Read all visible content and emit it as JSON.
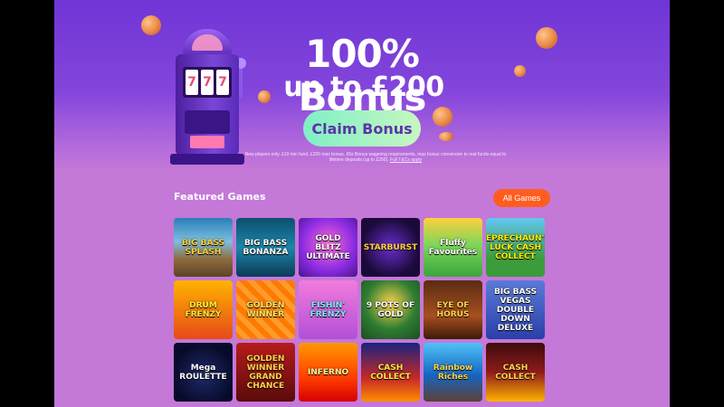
{
  "hero": {
    "headline": "100% Bonus",
    "subheadline": "up to £200",
    "claim_label": "Claim Bonus",
    "terms": "New players only. £10 min fund. £200 max bonus. 65x Bonus wagering requirements, max bonus conversion to real funds equal to lifetime deposits (up to £250).",
    "terms_link": "Full T&Cs apply"
  },
  "featured": {
    "title": "Featured Games",
    "all_games_label": "All Games"
  },
  "games": [
    {
      "name": "BIG BASS SPLASH"
    },
    {
      "name": "BIG BASS BONANZA"
    },
    {
      "name": "GOLD BLITZ ULTIMATE"
    },
    {
      "name": "STARBURST"
    },
    {
      "name": "Fluffy Favourites"
    },
    {
      "name": "LEPRECHAUN'S LUCK CASH COLLECT"
    },
    {
      "name": "DRUM FRENZY"
    },
    {
      "name": "GOLDEN WINNER"
    },
    {
      "name": "FISHIN' FRENZY"
    },
    {
      "name": "9 POTS OF GOLD"
    },
    {
      "name": "EYE OF HORUS"
    },
    {
      "name": "BIG BASS VEGAS DOUBLE DOWN DELUXE"
    },
    {
      "name": "Mega ROULETTE"
    },
    {
      "name": "GOLDEN WINNER GRAND CHANCE"
    },
    {
      "name": "INFERNO"
    },
    {
      "name": "CASH COLLECT"
    },
    {
      "name": "Rainbow Riches"
    },
    {
      "name": "CASH COLLECT"
    }
  ],
  "colors": {
    "hero_top": "#6f35d6",
    "page_bg": "#c478d8",
    "claim_button": "#7ff0c6",
    "all_games_button": "#ff5d1f"
  }
}
